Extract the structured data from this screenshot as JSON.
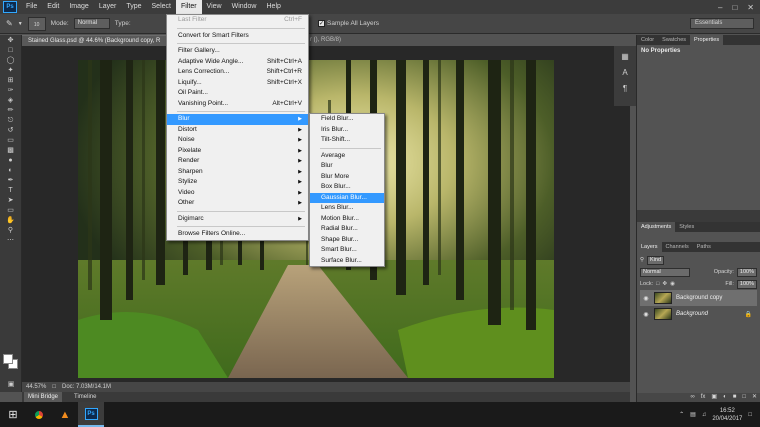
{
  "menubar": {
    "items": [
      "File",
      "Edit",
      "Image",
      "Layer",
      "Type",
      "Select",
      "Filter",
      "View",
      "Window",
      "Help"
    ],
    "active": "Filter"
  },
  "options": {
    "brush_size": "10",
    "mode_label": "Mode:",
    "mode_value": "Normal",
    "type_label": "Type:",
    "sample_all_layers": "Sample All Layers",
    "workspace": "Essentials"
  },
  "document": {
    "tab_title": "Stained Glass.psd @ 44.6% (Background copy, R",
    "tab_tail": "r (), RGB/8)",
    "zoom": "44.57%",
    "doc_size": "Doc: 7.03M/14.1M"
  },
  "bottom_tabs": [
    "Mini Bridge",
    "Timeline"
  ],
  "filter_menu": {
    "last_filter": {
      "label": "Last Filter",
      "shortcut": "Ctrl+F"
    },
    "smart": "Convert for Smart Filters",
    "gallery_group": [
      {
        "label": "Filter Gallery...",
        "shortcut": ""
      },
      {
        "label": "Adaptive Wide Angle...",
        "shortcut": "Shift+Ctrl+A"
      },
      {
        "label": "Lens Correction...",
        "shortcut": "Shift+Ctrl+R"
      },
      {
        "label": "Liquify...",
        "shortcut": "Shift+Ctrl+X"
      },
      {
        "label": "Oil Paint...",
        "shortcut": ""
      },
      {
        "label": "Vanishing Point...",
        "shortcut": "Alt+Ctrl+V"
      }
    ],
    "submenus": [
      "Blur",
      "Distort",
      "Noise",
      "Pixelate",
      "Render",
      "Sharpen",
      "Stylize",
      "Video",
      "Other"
    ],
    "digimarc": "Digimarc",
    "browse": "Browse Filters Online..."
  },
  "blur_menu": {
    "group1": [
      "Field Blur...",
      "Iris Blur...",
      "Tilt-Shift..."
    ],
    "group2": [
      "Average",
      "Blur",
      "Blur More",
      "Box Blur...",
      "Gaussian Blur...",
      "Lens Blur...",
      "Motion Blur...",
      "Radial Blur...",
      "Shape Blur...",
      "Smart Blur...",
      "Surface Blur..."
    ],
    "highlighted": "Gaussian Blur..."
  },
  "panels": {
    "props_tabs": [
      "Color",
      "Swatches",
      "Properties"
    ],
    "no_properties": "No Properties",
    "adj_tabs": [
      "Adjustments",
      "Styles"
    ],
    "layer_tabs": [
      "Layers",
      "Channels",
      "Paths"
    ],
    "kind": "Kind",
    "blend": "Normal",
    "opacity_label": "Opacity:",
    "opacity": "100%",
    "lock_label": "Lock:",
    "fill_label": "Fill:",
    "fill": "100%",
    "layers": [
      {
        "name": "Background copy",
        "selected": true,
        "italic": false
      },
      {
        "name": "Background",
        "selected": false,
        "italic": true
      }
    ]
  },
  "taskbar": {
    "time": "16:52",
    "date": "20/04/2017"
  },
  "colors": {
    "menu_highlight": "#3399ff",
    "ps_blue": "#31a8ff"
  }
}
